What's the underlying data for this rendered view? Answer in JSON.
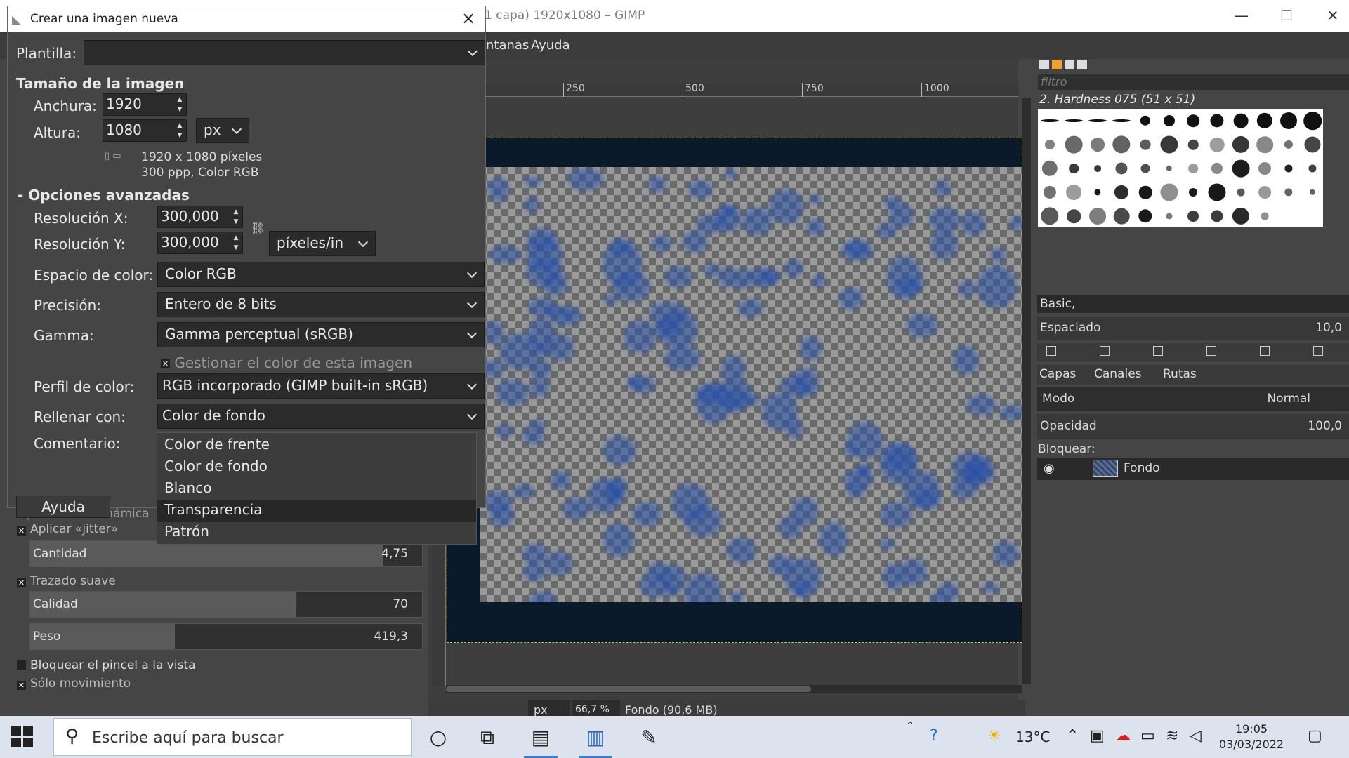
{
  "gimp_window": {
    "title": "1 capa) 1920x1080 – GIMP",
    "controls": {
      "minimize": "—",
      "maximize": "☐",
      "close": "✕"
    },
    "menu": [
      "ntanas",
      "Ayuda"
    ]
  },
  "ruler": {
    "ticks": [
      "250",
      "500",
      "750",
      "1000"
    ]
  },
  "statusbar": {
    "unit": "px",
    "zoom": "66,7 %",
    "info": "Fondo (90,6 MB)"
  },
  "brushes": {
    "filter_placeholder": "filtro",
    "current": "2. Hardness 075 (51 x 51)",
    "preset": "Basic,",
    "spacing_label": "Espaciado",
    "spacing_value": "10,0"
  },
  "layers": {
    "tabs": [
      "Capas",
      "Canales",
      "Rutas"
    ],
    "mode_label": "Modo",
    "mode_value": "Normal",
    "opacity_label": "Opacidad",
    "opacity_value": "100,0",
    "lock_label": "Bloquear:",
    "layer_name": "Fondo"
  },
  "tool_options": {
    "dynamics_partial": "Opciones de dinámica",
    "jitter": "Aplicar «jitter»",
    "amount_label": "Cantidad",
    "amount_value": "4,75",
    "amount_fraction": 0.9,
    "smooth": "Trazado suave",
    "quality_label": "Calidad",
    "quality_value": "70",
    "quality_fraction": 0.68,
    "weight_label": "Peso",
    "weight_value": "419,3",
    "weight_fraction": 0.37,
    "lock_brush": "Bloquear el pincel a la vista",
    "only_move": "Sólo movimiento"
  },
  "dialog": {
    "title": "Crear una imagen nueva",
    "template_label": "Plantilla:",
    "template_value": "",
    "image_size_title": "Tamaño de la imagen",
    "width_label": "Anchura:",
    "width_value": "1920",
    "height_label": "Altura:",
    "height_value": "1080",
    "size_unit": "px",
    "size_info_1": "1920 x 1080 píxeles",
    "size_info_2": "300 ppp, Color RGB",
    "advanced_title": "Opciones avanzadas",
    "advanced_toggle": "-",
    "xres_label": "Resolución X:",
    "xres_value": "300,000",
    "yres_label": "Resolución Y:",
    "yres_value": "300,000",
    "res_unit": "píxeles/in",
    "colorspace_label": "Espacio de color:",
    "colorspace_value": "Color RGB",
    "precision_label": "Precisión:",
    "precision_value": "Entero de 8 bits",
    "gamma_label": "Gamma:",
    "gamma_value": "Gamma perceptual (sRGB)",
    "manage_color": "Gestionar el color de esta imagen",
    "profile_label": "Perfil de color:",
    "profile_value": "RGB incorporado (GIMP built-in sRGB)",
    "fill_label": "Rellenar con:",
    "fill_value": "Color de fondo",
    "comment_label": "Comentario:",
    "help_button": "Ayuda",
    "fill_options": [
      "Color de frente",
      "Color de fondo",
      "Blanco",
      "Transparencia",
      "Patrón"
    ],
    "fill_highlighted_index": 3
  },
  "taskbar": {
    "search_placeholder": "Escribe aquí para buscar",
    "temperature": "13°C",
    "time": "19:05",
    "date": "03/03/2022"
  }
}
